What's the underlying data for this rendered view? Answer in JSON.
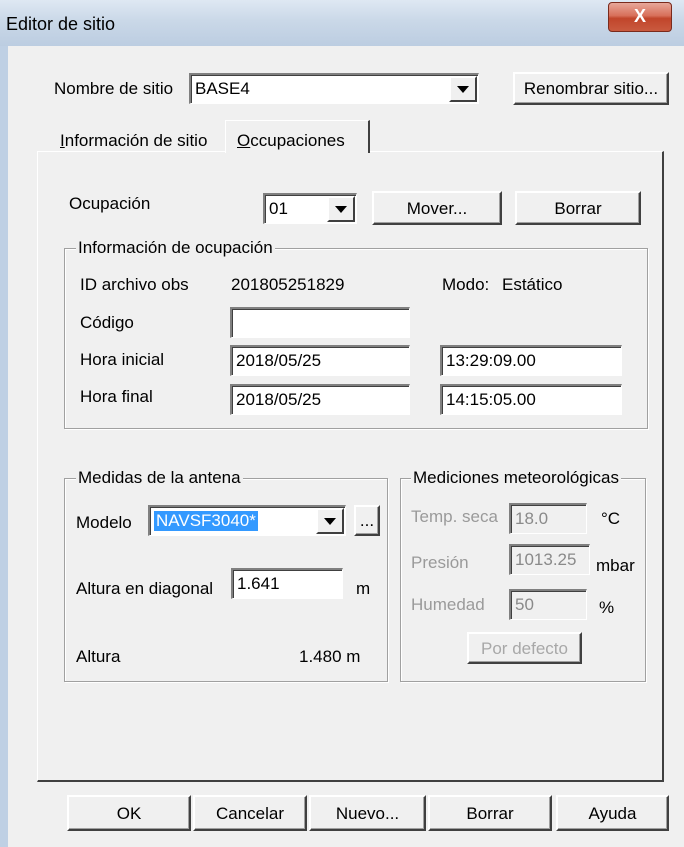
{
  "window": {
    "title": "Editor de sitio",
    "close_label": "X"
  },
  "site": {
    "name_label": "Nombre de sitio",
    "name_value": "BASE4",
    "rename_button": "Renombrar sitio..."
  },
  "tabs": [
    {
      "label_u": "I",
      "label_rest": "nformación de sitio"
    },
    {
      "label_u": "O",
      "label_rest": "ccupaciones"
    }
  ],
  "occupation": {
    "label": "Ocupación",
    "value": "01",
    "move_button": "Mover...",
    "delete_button": "Borrar"
  },
  "occupation_info": {
    "legend": "Información de ocupación",
    "obs_id_label": "ID archivo obs",
    "obs_id_value": "201805251829",
    "mode_label": "Modo:",
    "mode_value": "Estático",
    "code_label": "Código",
    "code_value": "",
    "start_label": "Hora inicial",
    "start_date": "2018/05/25",
    "start_time": "13:29:09.00",
    "end_label": "Hora final",
    "end_date": "2018/05/25",
    "end_time": "14:15:05.00"
  },
  "antenna": {
    "legend": "Medidas de la antena",
    "model_label": "Modelo",
    "model_value": "NAVSF3040*",
    "browse_button": "...",
    "slant_label": "Altura en diagonal",
    "slant_value": "1.641",
    "slant_unit": "m",
    "height_label": "Altura",
    "height_value": "1.480 m"
  },
  "meteo": {
    "legend": "Mediciones meteorológicas",
    "temp_label": "Temp. seca",
    "temp_value": "18.0",
    "temp_unit": "°C",
    "pressure_label": "Presión",
    "pressure_value": "1013.25",
    "pressure_unit": "mbar",
    "humidity_label": "Humedad",
    "humidity_value": "50",
    "humidity_unit": "%",
    "default_button": "Por defecto"
  },
  "footer": {
    "ok": "OK",
    "cancel": "Cancelar",
    "new": "Nuevo...",
    "delete": "Borrar",
    "help": "Ayuda"
  },
  "colors": {
    "selection": "#3399ff",
    "titlebar": "#c9d7e8",
    "close": "#c9482f"
  }
}
